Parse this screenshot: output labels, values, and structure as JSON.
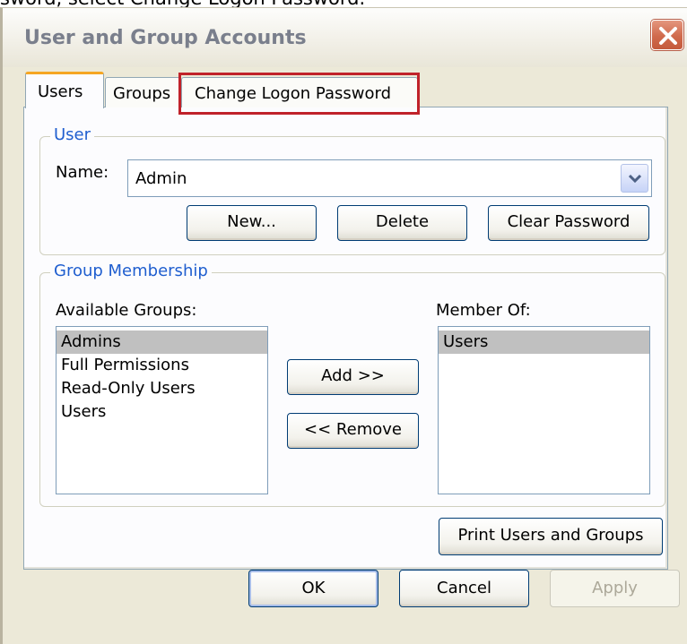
{
  "caption": "sword, select Change Logon Password.",
  "window": {
    "title": "User and Group Accounts"
  },
  "tabs": [
    {
      "label": "Users"
    },
    {
      "label": "Groups"
    },
    {
      "label": "Change Logon Password"
    }
  ],
  "user_group": {
    "legend": "User",
    "name_label": "Name:",
    "name_value": "Admin",
    "new_label": "New...",
    "delete_label": "Delete",
    "clear_password_label": "Clear Password"
  },
  "membership_group": {
    "legend": "Group Membership",
    "available_label": "Available Groups:",
    "member_of_label": "Member Of:",
    "available_groups": [
      "Admins",
      "Full Permissions",
      "Read-Only Users",
      "Users"
    ],
    "member_of": [
      "Users"
    ],
    "add_label": "Add >>",
    "remove_label": "<< Remove"
  },
  "print_label": "Print Users and Groups",
  "footer": {
    "ok_label": "OK",
    "cancel_label": "Cancel",
    "apply_label": "Apply"
  },
  "colors": {
    "accent_tab": "#f5a623",
    "legend_text": "#1f5ecf",
    "highlight": "#c0222a",
    "close_button": "#d06a4c"
  },
  "icons": {
    "close": "close-icon",
    "dropdown": "chevron-down-icon"
  }
}
